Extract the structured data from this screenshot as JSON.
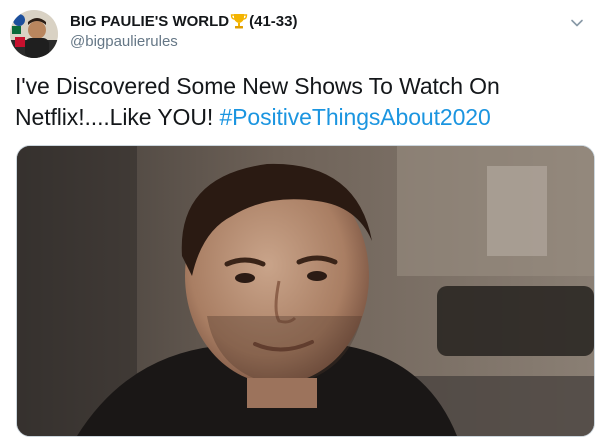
{
  "tweet": {
    "display_name": "BIG PAULIE'S WORLD",
    "name_suffix": "(41-33)",
    "handle": "@bigpaulierules",
    "text_main": "I've Discovered Some New Shows To Watch On Netflix!....Like YOU! ",
    "hashtag": "#PositiveThingsAbout2020"
  },
  "icons": {
    "avatar": "avatar-image",
    "badge": "trophy-icon",
    "menu": "chevron-down-icon"
  },
  "colors": {
    "hashtag": "#1b95e0",
    "handle": "#657786",
    "text": "#14171a"
  }
}
